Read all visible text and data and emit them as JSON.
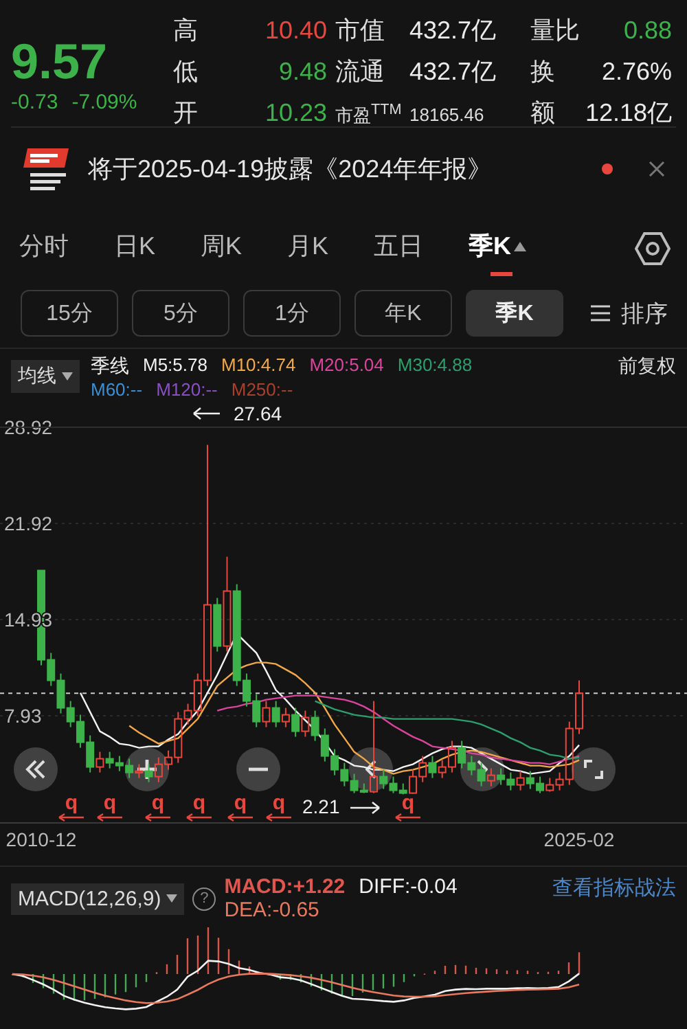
{
  "quote": {
    "price": "9.57",
    "change": "-0.73",
    "change_pct": "-7.09%",
    "color": "#3db24a"
  },
  "stats": [
    {
      "label": "高",
      "value": "10.40",
      "color": "#e8473e",
      "kind": "normal"
    },
    {
      "label": "市值",
      "value": "432.7亿",
      "color": "#ececec",
      "kind": "normal"
    },
    {
      "label": "量比",
      "value": "0.88",
      "color": "#3db24a",
      "kind": "normal"
    },
    {
      "label": "低",
      "value": "9.48",
      "color": "#3db24a",
      "kind": "normal"
    },
    {
      "label": "流通",
      "value": "432.7亿",
      "color": "#ececec",
      "kind": "normal"
    },
    {
      "label": "换",
      "value": "2.76%",
      "color": "#ececec",
      "kind": "normal"
    },
    {
      "label": "开",
      "value": "10.23",
      "color": "#3db24a",
      "kind": "normal"
    },
    {
      "label": "市盈$^{TTM}$",
      "value": "18165.46",
      "color": "#dddddd",
      "kind": "compact"
    },
    {
      "label": "额",
      "value": "12.18亿",
      "color": "#ececec",
      "kind": "normal"
    }
  ],
  "notice": {
    "text": "将于2025-04-19披露《2024年年报》",
    "unread": true
  },
  "period_tabs": [
    {
      "label": "分时",
      "selected": false
    },
    {
      "label": "日K",
      "selected": false
    },
    {
      "label": "周K",
      "selected": false
    },
    {
      "label": "月K",
      "selected": false
    },
    {
      "label": "五日",
      "selected": false
    },
    {
      "label": "季K",
      "selected": true
    }
  ],
  "period_chips": [
    {
      "label": "15分",
      "selected": false
    },
    {
      "label": "5分",
      "selected": false
    },
    {
      "label": "1分",
      "selected": false
    },
    {
      "label": "年K",
      "selected": false
    },
    {
      "label": "季K",
      "selected": true
    }
  ],
  "sort_button": {
    "label": "排序"
  },
  "indicator": {
    "dropdown": "均线",
    "series_label": "季线",
    "extra_values": [
      {
        "label": "M60:--",
        "color": "#3b8fd6"
      },
      {
        "label": "M120:--",
        "color": "#8a4fc4"
      },
      {
        "label": "M250:--",
        "color": "#a8402e"
      }
    ],
    "adjust": "前复权"
  },
  "price_chart": {
    "max_label": "27.64",
    "min_label": "2.21",
    "markers": [
      "q",
      "q",
      "q",
      "q",
      "q",
      "q",
      "q"
    ],
    "chart_data": {
      "type": "candlestick",
      "grid": true,
      "yticks": [
        {
          "value": 28.92,
          "label": "28.92"
        },
        {
          "value": 21.92,
          "label": "21.92"
        },
        {
          "value": 14.93,
          "label": "14.93"
        },
        {
          "value": 7.93,
          "label": "7.93"
        }
      ],
      "ylim": [
        0.13,
        28.92
      ],
      "ref_lines": [
        {
          "axis": "y",
          "value": 9.57
        }
      ],
      "categories": [
        "2010-12",
        null,
        null,
        null,
        null,
        null,
        null,
        null,
        null,
        null,
        null,
        null,
        null,
        null,
        null,
        null,
        null,
        null,
        null,
        null,
        null,
        null,
        null,
        null,
        null,
        null,
        null,
        null,
        null,
        null,
        null,
        null,
        null,
        null,
        null,
        null,
        null,
        null,
        null,
        null,
        null,
        null,
        null,
        null,
        null,
        null,
        null,
        null,
        null,
        null,
        null,
        null,
        null,
        null,
        null,
        "2025-02"
      ],
      "ohlc": [
        [
          18.5,
          18.5,
          11.6,
          12
        ],
        [
          12,
          12.5,
          10.1,
          10.5
        ],
        [
          10.5,
          11,
          8.1,
          8.5
        ],
        [
          8.5,
          9,
          7.1,
          7.5
        ],
        [
          7.5,
          8,
          5.6,
          6
        ],
        [
          6,
          6.5,
          3.8,
          4.2
        ],
        [
          4.2,
          5.3,
          3.8,
          4.8
        ],
        [
          4.8,
          5.3,
          4.1,
          4.5
        ],
        [
          4.5,
          5,
          3.9,
          4.3
        ],
        [
          4.3,
          4.8,
          3.4,
          3.8
        ],
        [
          3.8,
          4.4,
          3.4,
          3.9
        ],
        [
          3.9,
          4.4,
          3.1,
          3.5
        ],
        [
          3.5,
          4.9,
          3.1,
          4.4
        ],
        [
          4.4,
          5.4,
          4,
          4.9
        ],
        [
          4.9,
          8.2,
          4.5,
          7.7
        ],
        [
          7.7,
          8.8,
          7.3,
          8.3
        ],
        [
          8.3,
          11,
          7.9,
          10.5
        ],
        [
          10.5,
          27.64,
          10.1,
          16
        ],
        [
          16,
          16.5,
          12.6,
          13
        ],
        [
          13,
          19.5,
          12.6,
          17
        ],
        [
          17,
          17.5,
          10.1,
          10.5
        ],
        [
          10.5,
          11,
          8.6,
          9
        ],
        [
          9,
          9.5,
          7.1,
          7.5
        ],
        [
          7.5,
          9,
          7.1,
          8.5
        ],
        [
          8.5,
          9,
          7.1,
          7.5
        ],
        [
          7.5,
          8.5,
          7.1,
          8
        ],
        [
          8,
          8.5,
          6.4,
          6.8
        ],
        [
          6.8,
          8.3,
          6.4,
          7.8
        ],
        [
          7.8,
          8.3,
          6.1,
          6.5
        ],
        [
          6.5,
          7,
          4.6,
          5
        ],
        [
          5,
          5.5,
          3.6,
          4
        ],
        [
          4,
          4.5,
          2.8,
          3.2
        ],
        [
          3.2,
          3.7,
          2.3,
          2.5
        ],
        [
          2.5,
          3,
          2.3,
          2.4
        ],
        [
          2.4,
          9,
          2.3,
          3.5
        ],
        [
          3.5,
          4,
          2.6,
          3
        ],
        [
          3,
          3.5,
          2.3,
          2.5
        ],
        [
          2.5,
          3,
          2.21,
          2.3
        ],
        [
          2.3,
          4,
          2.25,
          3.5
        ],
        [
          3.5,
          5,
          3.1,
          4.5
        ],
        [
          4.5,
          5,
          3.4,
          3.8
        ],
        [
          3.8,
          4.7,
          3.4,
          4.2
        ],
        [
          4.2,
          6.1,
          3.8,
          5.6
        ],
        [
          5.6,
          6.1,
          4.1,
          4.5
        ],
        [
          4.5,
          5,
          3.6,
          4
        ],
        [
          4,
          4.5,
          2.8,
          3.2
        ],
        [
          3.2,
          4.1,
          2.8,
          3.6
        ],
        [
          3.6,
          4.1,
          2.9,
          3.3
        ],
        [
          3.3,
          3.8,
          2.5,
          2.9
        ],
        [
          2.9,
          3.9,
          2.5,
          3.4
        ],
        [
          3.4,
          3.9,
          2.6,
          3
        ],
        [
          3,
          3.5,
          2.3,
          2.5
        ],
        [
          2.5,
          3.4,
          2.4,
          2.9
        ],
        [
          2.9,
          3.8,
          2.5,
          3.3
        ],
        [
          3.3,
          7.5,
          2.9,
          7
        ],
        [
          7,
          10.5,
          6.6,
          9.57
        ]
      ],
      "series": [
        {
          "name": "M5:5.78",
          "type": "line",
          "color": "#f2f2f2",
          "values": [
            null,
            null,
            null,
            null,
            9.6,
            8.2,
            6.8,
            6.4,
            5.9,
            5.8,
            5.6,
            5.7,
            5.7,
            6.2,
            6.6,
            7.5,
            8.3,
            9.6,
            10.9,
            12.4,
            13.9,
            13.2,
            12.5,
            11.2,
            9.8,
            9.1,
            8.3,
            7.6,
            6.9,
            6.0,
            5.0,
            4.7,
            4.3,
            4.2,
            4.0,
            4.0,
            3.9,
            4.2,
            4.4,
            4.8,
            5.2,
            5.5,
            5.7,
            5.7,
            5.6,
            5.2,
            4.8,
            4.4,
            4.0,
            3.9,
            3.7,
            3.8,
            3.9,
            4.5,
            5.0,
            5.8
          ]
        },
        {
          "name": "M10:4.74",
          "type": "line",
          "color": "#f0a84a",
          "values": [
            null,
            null,
            null,
            null,
            null,
            null,
            null,
            null,
            null,
            7.2,
            6.7,
            6.3,
            5.9,
            6.1,
            6.3,
            7.0,
            7.7,
            8.9,
            10.1,
            10.7,
            11.3,
            11.6,
            11.8,
            11.8,
            11.7,
            11.3,
            10.9,
            10.3,
            9.6,
            8.5,
            7.3,
            6.3,
            5.3,
            4.8,
            4.2,
            4.0,
            3.7,
            3.9,
            4.0,
            4.2,
            4.4,
            4.8,
            5.1,
            5.3,
            5.4,
            5.3,
            5.1,
            4.9,
            4.7,
            4.5,
            4.3,
            4.3,
            4.2,
            4.3,
            4.4,
            4.7
          ]
        },
        {
          "name": "M20:5.04",
          "type": "line",
          "color": "#d9459c",
          "values": [
            null,
            null,
            null,
            null,
            null,
            null,
            null,
            null,
            null,
            null,
            null,
            null,
            null,
            null,
            null,
            null,
            null,
            null,
            8.3,
            8.5,
            8.6,
            8.8,
            8.9,
            9.1,
            9.2,
            9.3,
            9.4,
            9.4,
            9.4,
            9.3,
            9.2,
            9.1,
            8.9,
            8.6,
            8.2,
            7.7,
            7.2,
            6.8,
            6.4,
            6.1,
            5.7,
            5.6,
            5.5,
            5.4,
            5.2,
            5.1,
            4.9,
            4.8,
            4.7,
            4.6,
            4.5,
            4.5,
            4.4,
            4.6,
            4.8,
            5.0
          ]
        },
        {
          "name": "M30:4.88",
          "type": "line",
          "color": "#2f9e6e",
          "values": [
            null,
            null,
            null,
            null,
            null,
            null,
            null,
            null,
            null,
            null,
            null,
            null,
            null,
            null,
            null,
            null,
            null,
            null,
            null,
            null,
            null,
            null,
            null,
            null,
            null,
            null,
            null,
            null,
            9.0,
            8.7,
            8.4,
            8.2,
            8.0,
            7.9,
            7.8,
            7.8,
            7.7,
            7.7,
            7.7,
            7.7,
            7.7,
            7.7,
            7.7,
            7.6,
            7.5,
            7.3,
            7.0,
            6.7,
            6.3,
            6.0,
            5.6,
            5.4,
            5.1,
            5.0,
            4.8,
            4.9
          ]
        }
      ]
    }
  },
  "macd": {
    "dropdown": "MACD(12,26,9)",
    "help": "?",
    "values": [
      {
        "label": "MACD:+1.22",
        "color": "#e0574f"
      },
      {
        "label": "DIFF:-0.04",
        "color": "#f2f2f2"
      },
      {
        "label": "DEA:-0.65",
        "color": "#e8795f"
      }
    ],
    "link": "查看指标战法"
  }
}
